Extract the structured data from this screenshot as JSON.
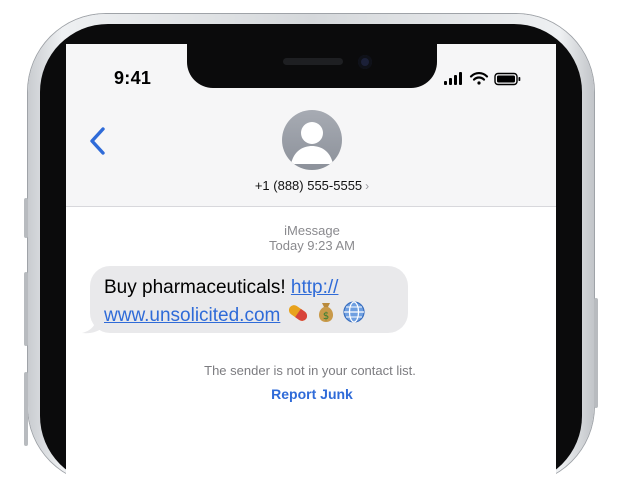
{
  "status_bar": {
    "time": "9:41"
  },
  "contact": {
    "phone": "+1 (888) 555-5555",
    "chevron": "›"
  },
  "conversation": {
    "service": "iMessage",
    "timestamp": "Today 9:23 AM",
    "message": {
      "text": "Buy pharmaceuticals! ",
      "link_line1": "http://",
      "link_line2": "www.unsolicited.com",
      "emojis": [
        "pill-icon",
        "money-bag-icon",
        "globe-icon"
      ]
    },
    "notice": "The sender is not in your contact list.",
    "report_label": "Report Junk"
  },
  "colors": {
    "accent": "#2f6bd8",
    "bubble": "#e9e9eb",
    "secondary_text": "#8a8a8e"
  }
}
